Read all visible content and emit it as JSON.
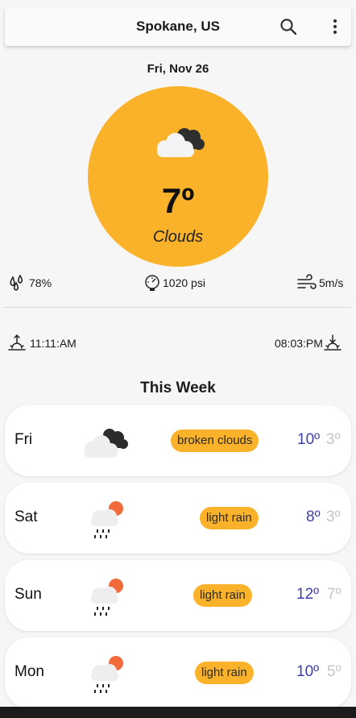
{
  "header": {
    "title": "Spokane, US",
    "search_icon": "search-icon",
    "menu_icon": "more-vertical-icon"
  },
  "current": {
    "date": "Fri, Nov 26",
    "temperature": "7º",
    "description": "Clouds",
    "icon": "cloudy-icon",
    "accent_color": "#fbb22b"
  },
  "stats": {
    "humidity": "78%",
    "pressure": "1020 psi",
    "wind": "5m/s"
  },
  "sun": {
    "sunrise": "11:11:AM",
    "sunset": "08:03:PM"
  },
  "week": {
    "title": "This Week",
    "days": [
      {
        "day": "Fri",
        "condition": "broken clouds",
        "high": "10º",
        "low": "3º",
        "icon": "broken-clouds-icon"
      },
      {
        "day": "Sat",
        "condition": "light rain",
        "high": "8º",
        "low": "3º",
        "icon": "light-rain-icon"
      },
      {
        "day": "Sun",
        "condition": "light rain",
        "high": "12º",
        "low": "7º",
        "icon": "light-rain-icon"
      },
      {
        "day": "Mon",
        "condition": "light rain",
        "high": "10º",
        "low": "5º",
        "icon": "light-rain-icon"
      }
    ]
  }
}
